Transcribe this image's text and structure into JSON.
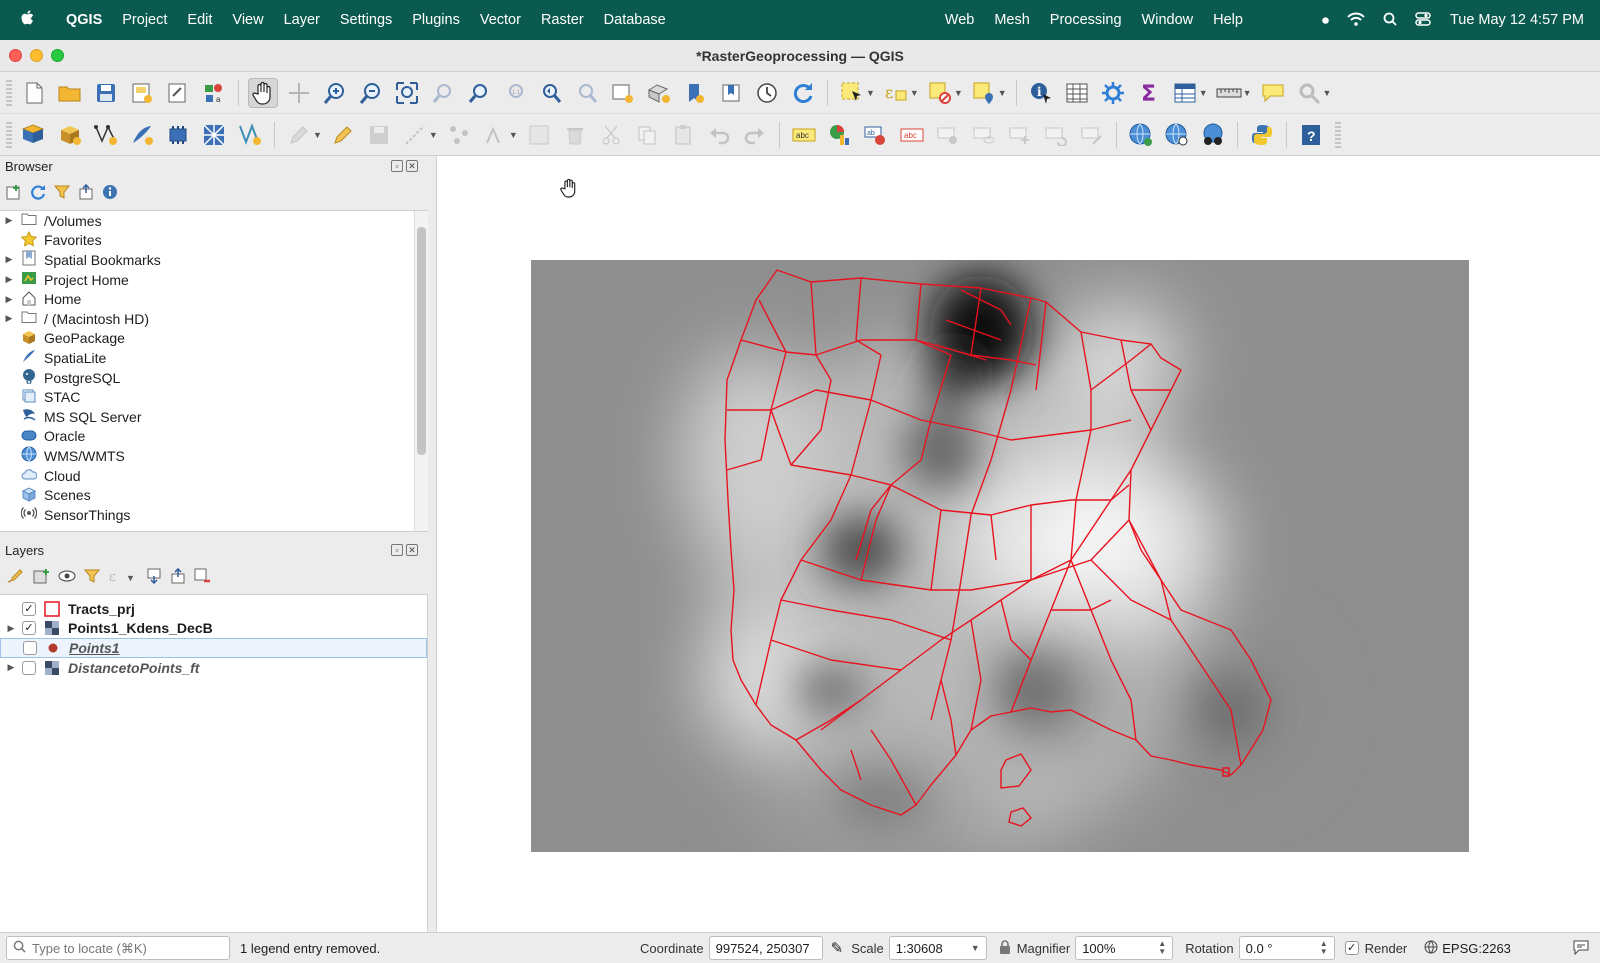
{
  "menubar": {
    "app": "QGIS",
    "items": [
      "Project",
      "Edit",
      "View",
      "Layer",
      "Settings",
      "Plugins",
      "Vector",
      "Raster",
      "Database"
    ],
    "right_items": [
      "Web",
      "Mesh",
      "Processing",
      "Window",
      "Help"
    ],
    "clock": "Tue May 12  4:57 PM"
  },
  "window": {
    "title": "*RasterGeoprocessing — QGIS"
  },
  "browser": {
    "title": "Browser",
    "items": [
      {
        "label": "/Volumes",
        "icon": "folder-icon"
      },
      {
        "label": "Favorites",
        "icon": "star-icon"
      },
      {
        "label": "Spatial Bookmarks",
        "icon": "bookmark-icon"
      },
      {
        "label": "Project Home",
        "icon": "project-home-icon"
      },
      {
        "label": "Home",
        "icon": "home-icon"
      },
      {
        "label": "/ (Macintosh HD)",
        "icon": "folder-icon"
      },
      {
        "label": "GeoPackage",
        "icon": "geopackage-icon"
      },
      {
        "label": "SpatiaLite",
        "icon": "spatialite-icon"
      },
      {
        "label": "PostgreSQL",
        "icon": "postgresql-icon"
      },
      {
        "label": "STAC",
        "icon": "stac-icon"
      },
      {
        "label": "MS SQL Server",
        "icon": "mssql-icon"
      },
      {
        "label": "Oracle",
        "icon": "oracle-icon"
      },
      {
        "label": "WMS/WMTS",
        "icon": "wms-icon"
      },
      {
        "label": "Cloud",
        "icon": "cloud-icon"
      },
      {
        "label": "Scenes",
        "icon": "scenes-icon"
      },
      {
        "label": "SensorThings",
        "icon": "sensorthings-icon"
      }
    ]
  },
  "layers": {
    "title": "Layers",
    "items": [
      {
        "label": "Tracts_prj",
        "checked": true,
        "symbol": "polygon-outline",
        "color": "#e8131f"
      },
      {
        "label": "Points1_Kdens_DecB",
        "checked": true,
        "symbol": "raster",
        "color": "#3a4a66"
      },
      {
        "label": "Points1",
        "checked": false,
        "symbol": "point",
        "color": "#b33a2a"
      },
      {
        "label": "DistancetoPoints_ft",
        "checked": false,
        "symbol": "raster",
        "color": "#3a4a66"
      }
    ]
  },
  "statusbar": {
    "locator_placeholder": "Type to locate (⌘K)",
    "message": "1 legend entry removed.",
    "coordinate_label": "Coordinate",
    "coordinate_value": "997524, 250307",
    "scale_label": "Scale",
    "scale_value": "1:30608",
    "magnifier_label": "Magnifier",
    "magnifier_value": "100%",
    "rotation_label": "Rotation",
    "rotation_value": "0.0 °",
    "render_label": "Render",
    "crs": "EPSG:2263"
  },
  "colors": {
    "menubar_bg": "#0b5a4f",
    "tract_outline": "#e8131f"
  }
}
